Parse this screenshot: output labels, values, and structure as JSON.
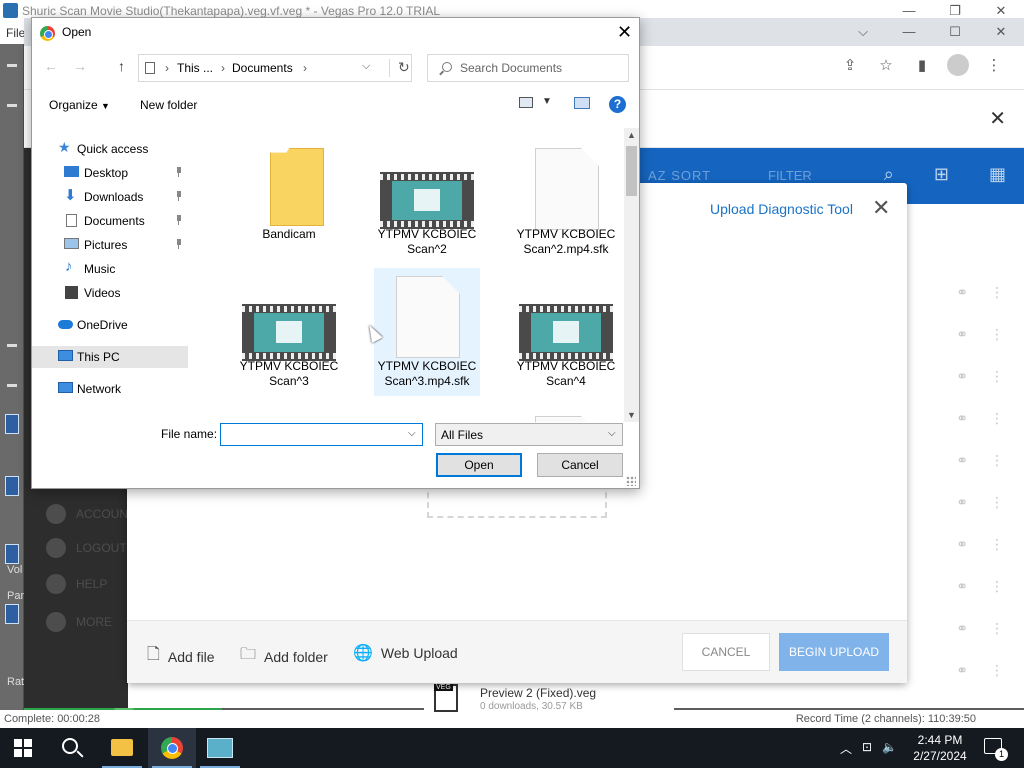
{
  "vegas": {
    "title": "Shuric Scan Movie Studio(Thekantapapa).veg.vf.veg * - Vegas Pro 12.0 TRIAL",
    "menu_file": "File",
    "side_labels": [
      "Vol",
      "Pan",
      "Rat"
    ],
    "status_left": "Complete: 00:00:28",
    "status_right": "Record Time (2 channels): 110:39:50"
  },
  "app": {
    "header_label": "AZ SORT",
    "header_label2": "FILTER",
    "sidebar_items": [
      "ACCOUNT",
      "LOGOUT",
      "HELP",
      "MORE"
    ],
    "bottom_item": {
      "badge": "VEG",
      "title": "Preview 2 (Fixed).veg",
      "meta": "0 downloads, 30.57 KB"
    }
  },
  "upload_modal": {
    "title": "Upload Diagnostic Tool",
    "add_file": "Add file",
    "add_folder": "Add folder",
    "web_upload": "Web Upload",
    "cancel": "CANCEL",
    "begin_upload": "BEGIN UPLOAD",
    "colors": {
      "title": "#1a73c8",
      "begin": "#7fb3ea"
    }
  },
  "dialog": {
    "title": "Open",
    "address": {
      "this_pc": "This ...",
      "folder": "Documents"
    },
    "search_placeholder": "Search Documents",
    "organize": "Organize",
    "new_folder": "New folder",
    "help": "?",
    "tree": {
      "quick_access": "Quick access",
      "items": [
        {
          "label": "Desktop",
          "icon": "desktop-icon",
          "pinned": true
        },
        {
          "label": "Downloads",
          "icon": "downloads-icon",
          "pinned": true
        },
        {
          "label": "Documents",
          "icon": "documents-icon",
          "pinned": true
        },
        {
          "label": "Pictures",
          "icon": "pictures-icon",
          "pinned": true
        },
        {
          "label": "Music",
          "icon": "music-icon",
          "pinned": false
        },
        {
          "label": "Videos",
          "icon": "videos-icon",
          "pinned": false
        }
      ],
      "onedrive": "OneDrive",
      "this_pc": "This PC",
      "network": "Network"
    },
    "files": [
      {
        "type": "folder",
        "label": "Bandicam"
      },
      {
        "type": "video",
        "label": "YTPMV KCBOIEC Scan^2"
      },
      {
        "type": "blank",
        "label": "YTPMV KCBOIEC Scan^2.mp4.sfk"
      },
      {
        "type": "video",
        "label": "YTPMV KCBOIEC Scan^3"
      },
      {
        "type": "blank",
        "label": "YTPMV KCBOIEC Scan^3.mp4.sfk"
      },
      {
        "type": "video",
        "label": "YTPMV KCBOIEC Scan^4"
      }
    ],
    "file_name_label": "File name:",
    "file_name_value": "",
    "file_type": "All Files",
    "open": "Open",
    "cancel": "Cancel"
  },
  "taskbar": {
    "time": "2:44 PM",
    "date": "2/27/2024",
    "notification_count": "1"
  }
}
